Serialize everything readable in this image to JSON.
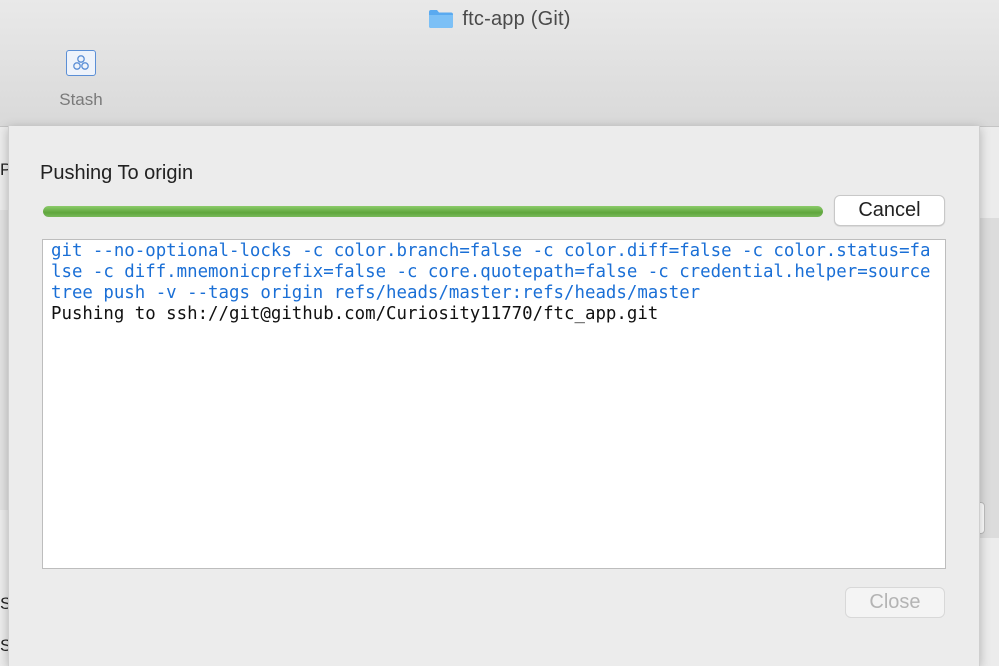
{
  "window": {
    "title": "ftc-app (Git)",
    "toolbar": {
      "stash_label": "Stash"
    }
  },
  "background_fragments": [
    "P",
    "S",
    "S",
    "S"
  ],
  "dialog": {
    "title": "Pushing To origin",
    "progress_percent": 100,
    "cancel_label": "Cancel",
    "close_label": "Close",
    "log": {
      "command": "git --no-optional-locks -c color.branch=false -c color.diff=false -c color.status=false -c diff.mnemonicprefix=false -c core.quotepath=false -c credential.helper=sourcetree push -v --tags origin refs/heads/master:refs/heads/master",
      "output": "Pushing to ssh://git@github.com/Curiosity11770/ftc_app.git"
    }
  },
  "colors": {
    "command_text": "#1a6fd6",
    "progress": "#6ab04c",
    "folder": "#5aaaf0"
  },
  "icons": [
    "folder-icon",
    "stash-icon"
  ]
}
